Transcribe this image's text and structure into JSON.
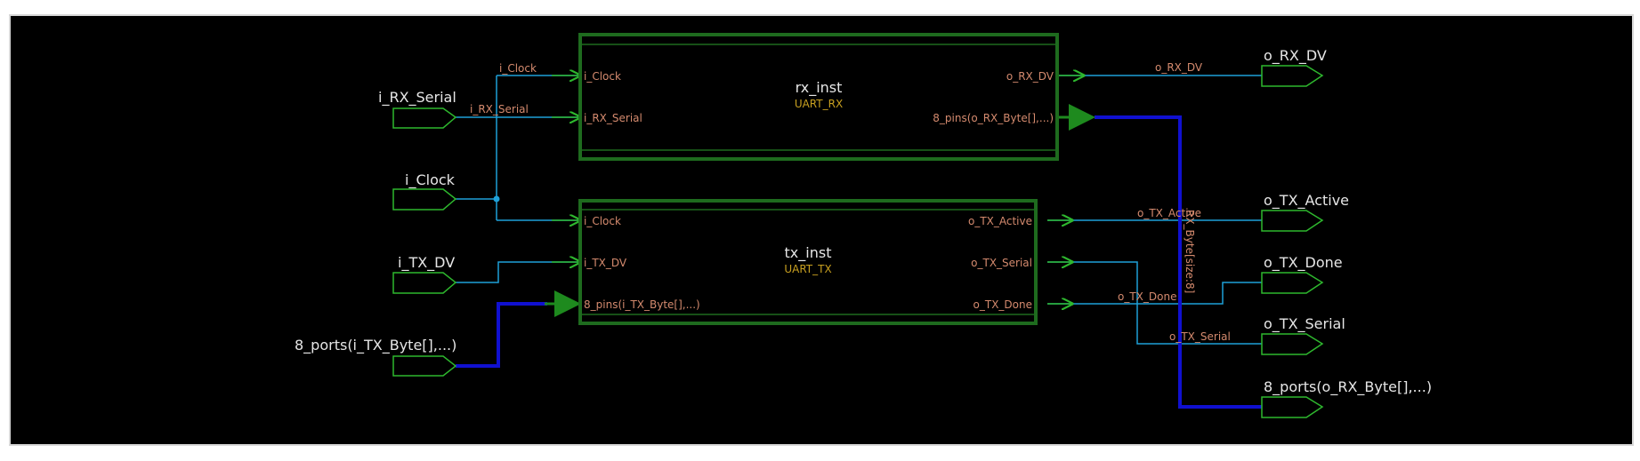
{
  "colors": {
    "background": "#000000",
    "block_border": "#1e6b1e",
    "port_outline": "#2eb82e",
    "wire": "#1ea0d8",
    "bus": "#1010d0",
    "pin_label": "#d48a6e",
    "inst_type": "#c8a020"
  },
  "input_ports": [
    {
      "label": "i_RX_Serial"
    },
    {
      "label": "i_Clock"
    },
    {
      "label": "i_TX_DV"
    },
    {
      "label": "8_ports(i_TX_Byte[],...)"
    }
  ],
  "output_ports": [
    {
      "label": "o_RX_DV"
    },
    {
      "label": "o_TX_Active"
    },
    {
      "label": "o_TX_Done"
    },
    {
      "label": "o_TX_Serial"
    },
    {
      "label": "8_ports(o_RX_Byte[],...)"
    }
  ],
  "instances": [
    {
      "name": "rx_inst",
      "type": "UART_RX",
      "input_pins": [
        "i_Clock",
        "i_RX_Serial"
      ],
      "output_pins": [
        "o_RX_DV",
        "8_pins(o_RX_Byte[],...)"
      ]
    },
    {
      "name": "tx_inst",
      "type": "UART_TX",
      "input_pins": [
        "i_Clock",
        "i_TX_DV",
        "8_pins(i_TX_Byte[],...)"
      ],
      "output_pins": [
        "o_TX_Active",
        "o_TX_Serial",
        "o_TX_Done"
      ]
    }
  ],
  "net_labels": {
    "clock": "i_Clock",
    "rx_serial": "i_RX_Serial",
    "rx_dv": "o_RX_DV",
    "tx_active": "o_TX_Active",
    "tx_done": "o_TX_Done",
    "tx_serial": "o_TX_Serial",
    "rx_byte_bus": "RX_Byte[size:8]"
  }
}
